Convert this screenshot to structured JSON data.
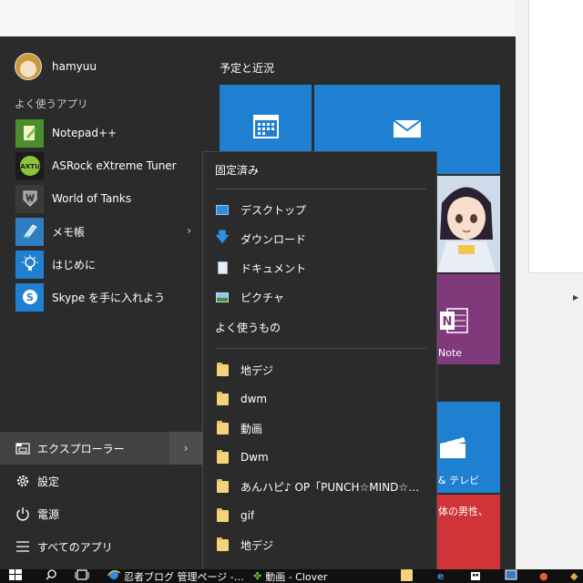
{
  "user": {
    "name": "hamyuu"
  },
  "sections": {
    "most_used": "よく使うアプリ",
    "tiles_title": "予定と近況"
  },
  "apps": [
    {
      "label": "Notepad++",
      "icon": "notepadpp-icon",
      "color": "#6bbf3a"
    },
    {
      "label": "ASRock eXtreme Tuner",
      "icon": "asrock-icon",
      "color": "#8cc63f"
    },
    {
      "label": "World of Tanks",
      "icon": "world-of-tanks-icon",
      "color": "#4a4a4a"
    },
    {
      "label": "メモ帳",
      "icon": "notepad-icon",
      "color": "#2d7fc1",
      "chevron": "›"
    },
    {
      "label": "はじめに",
      "icon": "lightbulb-icon",
      "color": "#1f7fd1"
    },
    {
      "label": "Skype を手に入れよう",
      "icon": "skype-icon",
      "color": "#1f7fd1"
    }
  ],
  "bottom": [
    {
      "label": "エクスプローラー",
      "icon": "file-explorer-icon",
      "chevron": "›"
    },
    {
      "label": "設定",
      "icon": "gear-icon"
    },
    {
      "label": "電源",
      "icon": "power-icon"
    },
    {
      "label": "すべてのアプリ",
      "icon": "all-apps-icon"
    }
  ],
  "tiles": {
    "onenote_label": "Note",
    "movies_label": "& テレビ",
    "news_snippet": "体の男性、"
  },
  "jump_list": {
    "pinned_header": "固定済み",
    "pinned": [
      {
        "label": "デスクトップ",
        "icon": "desktop-icon"
      },
      {
        "label": "ダウンロード",
        "icon": "download-icon"
      },
      {
        "label": "ドキュメント",
        "icon": "document-icon"
      },
      {
        "label": "ピクチャ",
        "icon": "pictures-icon"
      }
    ],
    "frequent_header": "よく使うもの",
    "frequent": [
      {
        "label": "地デジ"
      },
      {
        "label": "dwm"
      },
      {
        "label": "動画"
      },
      {
        "label": "Dwm"
      },
      {
        "label": "あんハピ♪ OP「PUNCH☆MIND☆…"
      },
      {
        "label": "gif"
      },
      {
        "label": "地デジ"
      }
    ]
  },
  "taskbar": {
    "items": [
      {
        "label": "忍者ブログ 管理ページ -…",
        "icon": "ie-icon"
      },
      {
        "label": "動画 - Clover",
        "icon": "clover-icon"
      }
    ]
  },
  "colors": {
    "menu_bg": "#2b2b2b",
    "accent": "#1f7fd1",
    "onenote": "#80397b",
    "news": "#d13438"
  }
}
